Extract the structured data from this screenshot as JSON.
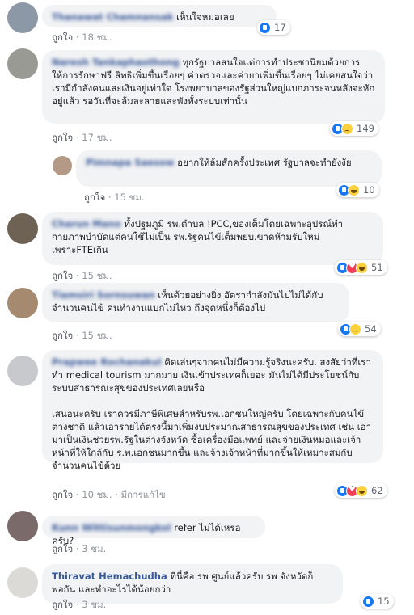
{
  "actions": {
    "like": "ถูกใจ",
    "separator": "·",
    "edited": "มีการแก้ไข"
  },
  "comments": [
    {
      "name": "Thanawat Chamnansak",
      "text": "เห็นใจหมอเลย",
      "time": "18 ชม.",
      "reactions": [
        "like"
      ],
      "count": "17"
    },
    {
      "name": "Naresh Tankaphaothong",
      "text": "ทุกรัฐบาลสนใจแต่การทำประชานิยมด้วยการให้การรักษาฟรี สิทธิเพิ่มขึ้นเรื่อยๆ ค่าตรวจและค่ายาเพิ่มขึ้นเรื่อยๆ ไม่เคยสนใจว่าเรามีกำลังคนและเงินอยู่เท่าใด โรงพยาบาลของรัฐส่วนใหญ่แบกภาระจนหลังจะหักอยู่แล้ว รอวันที่จะล้มละลายและพังทั้งระบบเท่านั้น",
      "time": "17 ชม.",
      "reactions": [
        "like",
        "sad"
      ],
      "count": "149"
    },
    {
      "name": "Pimnapa Saesow",
      "text": "อยากให้ล้มสักครั้งประเทศ รัฐบาลจะทำยังงัย",
      "time": "15 ชม.",
      "reactions": [
        "like",
        "haha"
      ],
      "count": "10"
    },
    {
      "name": "Charun Mano",
      "text": "ทั้งปฐมภูมิ รพ.ตำบล !PCC,ของเต็มโดยเฉพาะอุปรณ์ทำกายภาพบำบัดแต่คนใช้ไม่เป็น รพ.รัฐคนไข้เต็มพยบ.ขาดห้ามรับใหม่เพราะFTEเกิน",
      "time": "15 ชม.",
      "reactions": [
        "like",
        "love",
        "haha"
      ],
      "count": "51"
    },
    {
      "name": "Tiamsiri Sornsuwan",
      "text": "เห็นด้วยอย่างยิ่ง อัตรากำลังมันไปไม่ได้กับจำนวนคนไข้ คนทำงานแบกไม่ไหว ถึงจุดหนึ่งก็ต้องไป",
      "time": "15 ชม.",
      "reactions": [
        "like",
        "sad"
      ],
      "count": "54"
    },
    {
      "name": "Prapwee Rochanakul",
      "text": "คิดเล่นๆจากคนไม่มีความรู้จริงนะครับ. สงสัยว่าที่เราทำ medical tourism มากมาย เงินเข้าประเทศก็เยอะ มันไม่ได้มีประโยชน์กับระบบสาธารณะสุขของประเทศเลยหรือ\n\nเสนอนะครับ เราควรมีภาษีพิเศษสำหรับรพ.เอกชนใหญ่ครับ โดยเฉพาะกับคนไข้ต่างชาติ แล้วเอารายได้ตรงนี้มาเพิ่มงบประมาณสาธารณสุขของประเทศ เช่น เอามาเป็นเงินช่วยรพ.รัฐในต่างจังหวัด ซื้อเครื่องมือแพทย์ และจ่ายเงินหมอและเจ้าหน้าที่ให้ใกล้กับ ร.พ.เอกชนมากขึ้น และจ้างเจ้าหน้าที่มากขึ้นให้เหมาะสมกับจำนวนคนไข้ด้วย",
      "time": "10 ชม.",
      "edited": true,
      "reactions": [
        "like",
        "love",
        "haha"
      ],
      "count": "62"
    },
    {
      "name": "Kunn Wittisunmongkol",
      "text": "refer ไม่ได้เหรอครับ?",
      "time": "3 ชม.",
      "reactions": [],
      "count": ""
    },
    {
      "name": "Thiravat Hemachudha",
      "text": "ที่นี่คือ รพ ศูนย์แล้วครับ รพ จังหวัดก็พอกัน และทำอะไรได้น้อยกว่า",
      "time": "3 ชม.",
      "reactions": [
        "like"
      ],
      "count": "15"
    }
  ]
}
